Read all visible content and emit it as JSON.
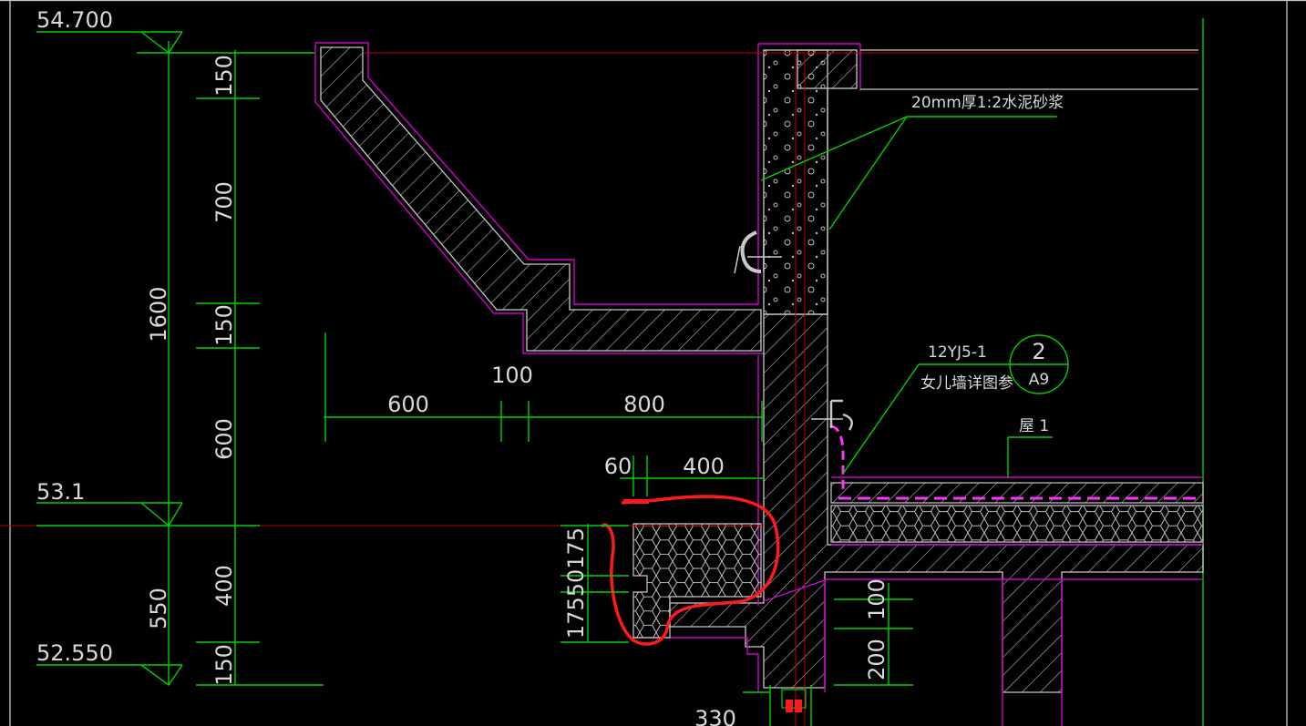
{
  "colors": {
    "background": "#000000",
    "dimension_line": "#00d000",
    "section_outline": "#d000d0",
    "structure_line": "#c8c8c8",
    "axis_line": "#c00000",
    "markup": "#ff1a1a"
  },
  "elevations": {
    "top": "54.700",
    "middle": "53.1",
    "bottom": "52.550"
  },
  "dimensions": {
    "left_overall": "1600",
    "left_lower_overall": "550",
    "seg_150_top": "150",
    "seg_700": "700",
    "seg_150_mid": "150",
    "seg_600": "600",
    "seg_400": "400",
    "seg_150_bottom": "150",
    "h_600": "600",
    "h_100": "100",
    "h_800": "800",
    "h_60": "60",
    "h_400": "400",
    "v_small": "17550175",
    "right_100": "100",
    "right_200": "200",
    "bottom_330": "330"
  },
  "notes": {
    "mortar": "20mm厚1:2水泥砂浆",
    "ref_code": "12YJ5-1",
    "ref_text": "女儿墙详图参",
    "circle_top": "2",
    "circle_bottom": "A9",
    "roof_label": "屋 1"
  },
  "icons": [
    "grip-handle-icon",
    "section-marker-icon"
  ]
}
